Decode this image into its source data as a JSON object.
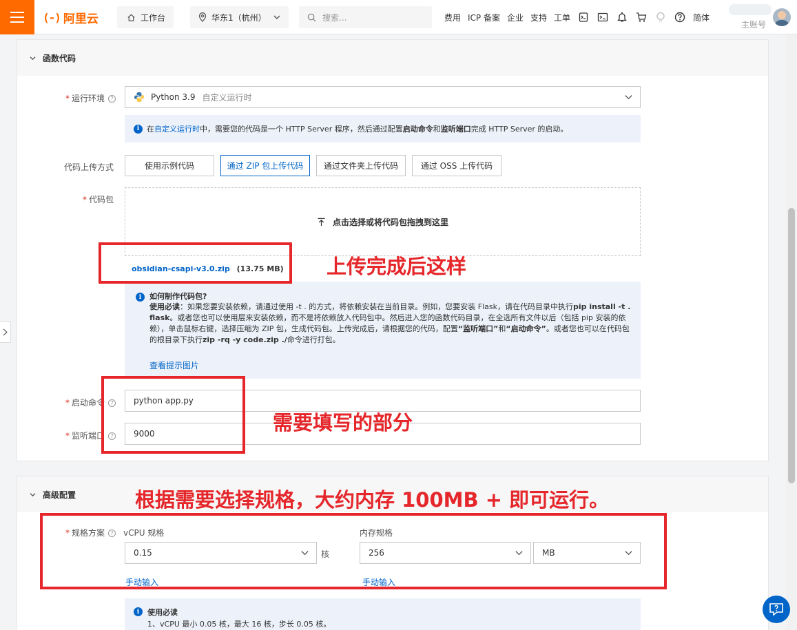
{
  "topbar": {
    "logo_text": "阿里云",
    "workbench": "工作台",
    "region": "华东1（杭州）",
    "search_placeholder": "搜索...",
    "links": [
      "费用",
      "ICP 备案",
      "企业",
      "支持",
      "工单"
    ],
    "lang": "简体",
    "account_label": "主账号"
  },
  "function_code": {
    "section_title": "函数代码",
    "runtime_label": "运行环境",
    "runtime_value": "Python 3.9",
    "runtime_sub": "自定义运行时",
    "runtime_info": {
      "prefix": "在",
      "link": "自定义运行时",
      "mid": "中，需要您的代码是一个 HTTP Server 程序，然后通过配置",
      "bold1": "启动命令",
      "and": "和",
      "bold2": "监听端口",
      "suffix": "完成 HTTP Server 的启动。"
    },
    "upload_method_label": "代码上传方式",
    "upload_methods": [
      "使用示例代码",
      "通过 ZIP 包上传代码",
      "通过文件夹上传代码",
      "通过 OSS 上传代码"
    ],
    "code_pkg_label": "代码包",
    "dropzone_text": "点击选择或将代码包拖拽到这里",
    "file_name": "obsidian-csapi-v3.0.zip",
    "file_size": "(13.75 MB)",
    "howto": {
      "title": "如何制作代码包?",
      "lead": "使用必读",
      "body1": "：如果您要安装依赖，请通过使用 -t . 的方式，将依赖安装在当前目录。例如，您要安装 Flask，请在代码目录中执行",
      "cmd1": "pip install -t . flask",
      "body2": "。或者您也可以使用层来安装依赖，而不是将依赖放入代码包中。然后进入您的函数代码目录，在全选所有文件以后（包括 pip 安装的依赖），单击鼠标右键，选择压缩为 ZIP 包，生成代码包。上传完成后，请根据您的代码，配置",
      "q1": "“监听端口”",
      "and": "和",
      "q2": "“启动命令”",
      "body3": "。或者您也可以在代码包的根目录下执行",
      "cmd2": "zip -rq -y code.zip ./",
      "body4": "命令进行打包。",
      "link": "查看提示图片"
    },
    "start_cmd_label": "启动命令",
    "start_cmd_value": "python app.py",
    "port_label": "监听端口",
    "port_value": "9000"
  },
  "advanced": {
    "section_title": "高级配置",
    "spec_label": "规格方案",
    "vcpu_label": "vCPU 规格",
    "vcpu_value": "0.15",
    "vcpu_unit": "核",
    "mem_label": "内存规格",
    "mem_value": "256",
    "mem_unit": "MB",
    "manual_input": "手动输入",
    "notice_title": "使用必读",
    "notice_line1": "1、vCPU 最小 0.05 核，最大 16 核，步长 0.05 核。"
  },
  "annotations": {
    "note1": "上传完成后这样",
    "note2": "需要填写的部分",
    "note3": "根据需要选择规格，大约内存 100MB + 即可运行。"
  },
  "colors": {
    "brand": "#ff6a00",
    "link": "#0064c8",
    "annotation": "#e5262a",
    "info_bg": "#edf2fa"
  }
}
